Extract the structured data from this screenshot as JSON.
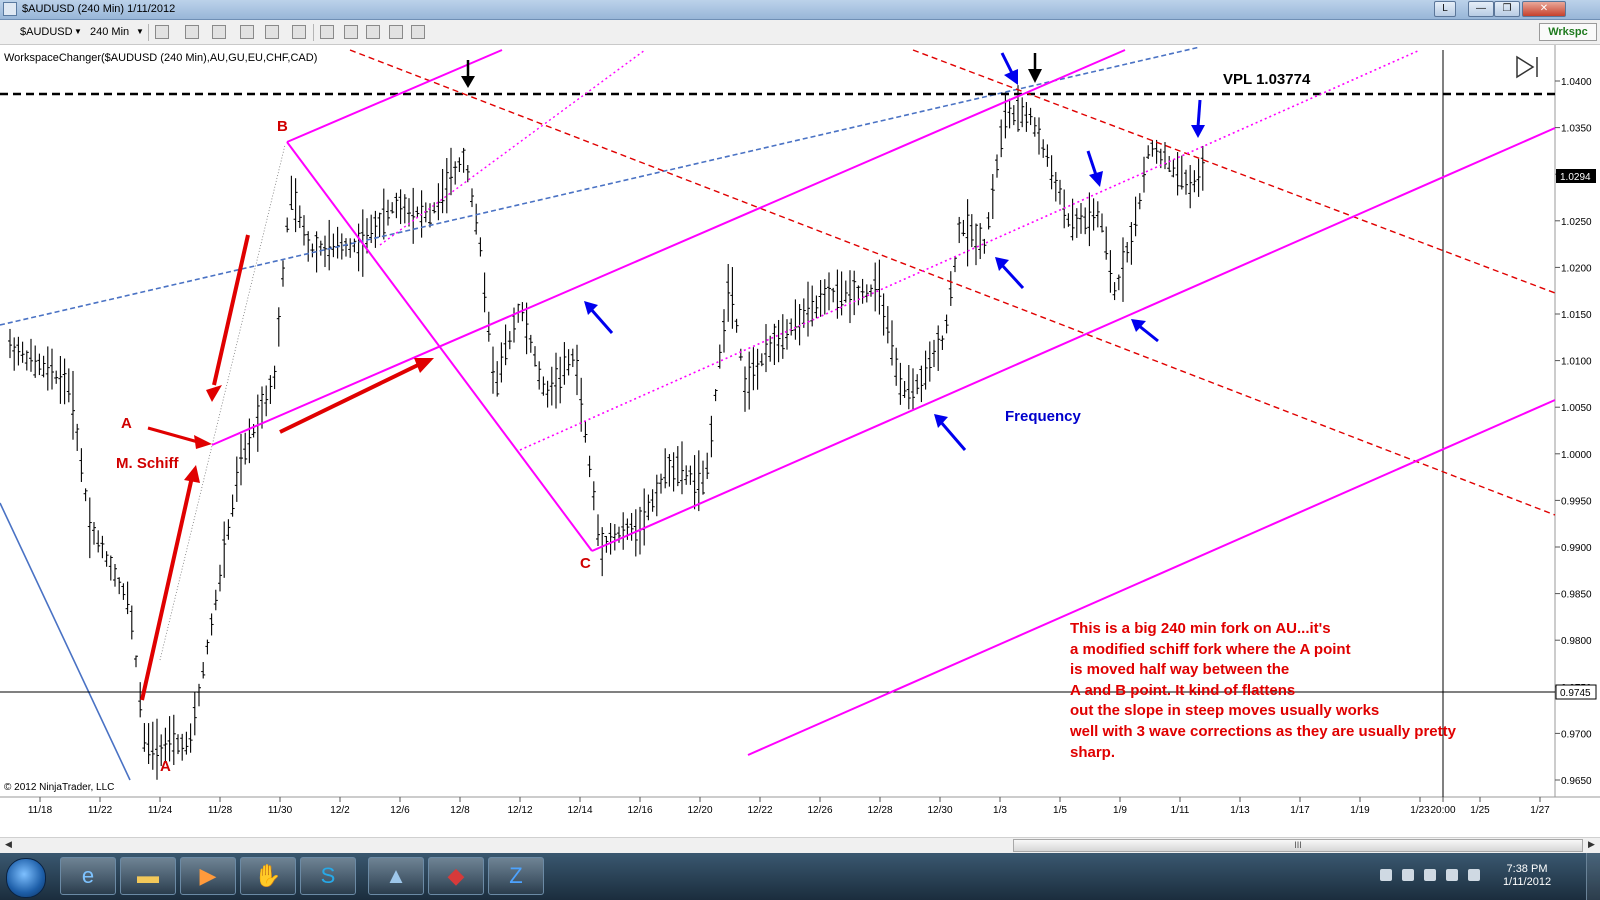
{
  "window": {
    "title": "$AUDUSD (240 Min)  1/11/2012",
    "controls": [
      "L",
      "—",
      "❐",
      "✕"
    ]
  },
  "toolbar": {
    "instrument": "$AUDUSD",
    "interval": "240 Min",
    "workspace_label": "Wrkspc"
  },
  "chart": {
    "indicator_label": "WorkspaceChanger($AUDUSD (240 Min),AU,GU,EU,CHF,CAD)",
    "copyright": "© 2012 NinjaTrader, LLC",
    "price_ticks": [
      "1.0400",
      "1.0350",
      "1.0300",
      "1.0250",
      "1.0200",
      "1.0150",
      "1.0100",
      "1.0050",
      "1.0000",
      "0.9950",
      "0.9900",
      "0.9850",
      "0.9800",
      "0.9750",
      "0.9700",
      "0.9650"
    ],
    "last_price": "1.0294",
    "crosshair_price": "0.9745",
    "date_ticks": [
      "11/18",
      "11/22",
      "11/24",
      "11/28",
      "11/30",
      "12/2",
      "12/6",
      "12/8",
      "12/12",
      "12/14",
      "12/16",
      "12/20",
      "12/22",
      "12/26",
      "12/28",
      "12/30",
      "1/3",
      "1/5",
      "1/9",
      "1/11",
      "1/13",
      "1/17",
      "1/19",
      "1/23",
      "20:00",
      "1/25",
      "1/27"
    ],
    "labels": {
      "point_b": "B",
      "point_a": "A",
      "point_a_low": "A",
      "point_c": "C",
      "schiff": "M. Schiff",
      "vpl": "VPL 1.03774",
      "frequency": "Frequency"
    },
    "note_lines": [
      "This is a big 240 min fork on AU...it's",
      "a modified schiff fork where the A point",
      "is moved half way between the",
      "A and B point.  It kind of flattens",
      "out the slope in steep moves usually works",
      "well with 3 wave corrections as they are usually pretty",
      "sharp."
    ],
    "colors": {
      "fork": "#ff00ff",
      "annotation": "#e00000",
      "arrow_blue": "#0000ee",
      "trendline_blue": "#4a72c4",
      "bars": "#000000"
    }
  },
  "scroll": {
    "thumb_label": "III"
  },
  "taskbar": {
    "time": "7:38 PM",
    "date": "1/11/2012"
  }
}
